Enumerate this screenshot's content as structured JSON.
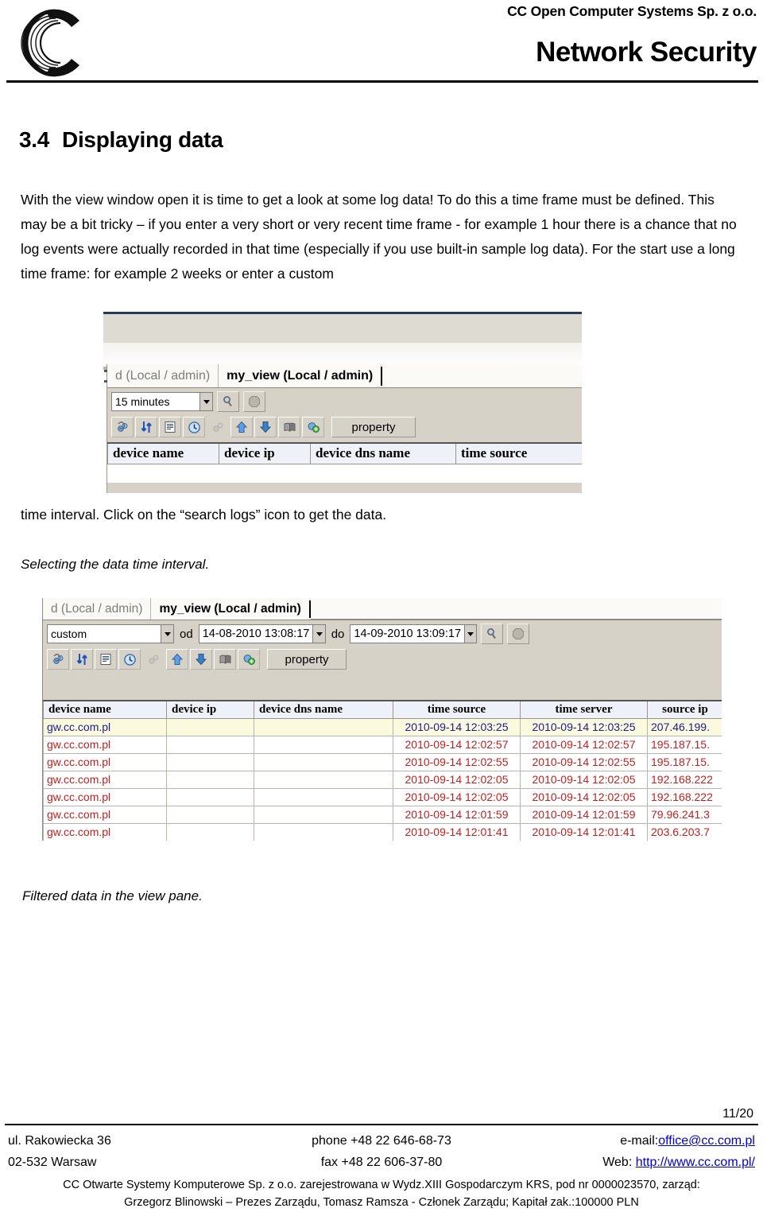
{
  "header": {
    "company": "CC Open Computer Systems Sp. z o.o.",
    "doc_title": "Network Security",
    "logo_icon": "cc-logo-arcs-icon"
  },
  "section": {
    "number": "3.4",
    "title": "Displaying data"
  },
  "body": {
    "paragraph1": "With the view window open it is time to get a look at some log data! To do this a time frame must be defined. This may be a bit tricky – if you enter a very short or very recent time frame - for example 1 hour there is a chance that no log events were actually recorded in that time (especially if you use built-in sample log data). For the start use a long time frame: for example 2 weeks or enter a custom",
    "paragraph1_cont": "time interval. Click on the “search logs” icon to get the data.",
    "caption1": "Selecting the data time interval.",
    "caption2": "Filtered data in the view pane."
  },
  "screenshot1": {
    "tabs": [
      {
        "label": "d (Local / admin)",
        "active": false
      },
      {
        "label": "my_view (Local / admin)",
        "active": true
      }
    ],
    "timeframe_combo": {
      "value": "15 minutes"
    },
    "buttons": {
      "search_logs": "search-logs-icon",
      "stop": "stop-icon",
      "property": "property"
    },
    "toolbar_icons": [
      "refresh-icon",
      "sort-updown-icon",
      "report-icon",
      "clock-icon",
      "filter-icon",
      "arrow-up-icon",
      "arrow-down-icon",
      "book-icon",
      "add-view-icon"
    ],
    "columns": [
      "device name",
      "device ip",
      "device dns name",
      "time source"
    ]
  },
  "screenshot2": {
    "tabs": [
      {
        "label": "d (Local / admin)",
        "active": false
      },
      {
        "label": "my_view (Local / admin)",
        "active": true
      }
    ],
    "timeframe_combo": {
      "value": "custom"
    },
    "from_label": "od",
    "from_value": "14-08-2010 13:08:17",
    "to_label": "do",
    "to_value": "14-09-2010 13:09:17",
    "buttons": {
      "search_logs": "search-logs-icon",
      "stop": "stop-icon",
      "property": "property"
    },
    "toolbar_icons": [
      "refresh-icon",
      "sort-updown-icon",
      "report-icon",
      "clock-icon",
      "filter-icon",
      "arrow-up-icon",
      "arrow-down-icon",
      "book-icon",
      "add-view-icon"
    ],
    "columns": [
      "device name",
      "device ip",
      "device dns name",
      "time source",
      "time server",
      "source ip"
    ],
    "rows": [
      {
        "selected": true,
        "device_name": "gw.cc.com.pl",
        "device_ip": "",
        "device_dns_name": "",
        "time_source": "2010-09-14 12:03:25",
        "time_server": "2010-09-14 12:03:25",
        "source_ip": "207.46.199."
      },
      {
        "selected": false,
        "device_name": "gw.cc.com.pl",
        "device_ip": "",
        "device_dns_name": "",
        "time_source": "2010-09-14 12:02:57",
        "time_server": "2010-09-14 12:02:57",
        "source_ip": "195.187.15."
      },
      {
        "selected": false,
        "device_name": "gw.cc.com.pl",
        "device_ip": "",
        "device_dns_name": "",
        "time_source": "2010-09-14 12:02:55",
        "time_server": "2010-09-14 12:02:55",
        "source_ip": "195.187.15."
      },
      {
        "selected": false,
        "device_name": "gw.cc.com.pl",
        "device_ip": "",
        "device_dns_name": "",
        "time_source": "2010-09-14 12:02:05",
        "time_server": "2010-09-14 12:02:05",
        "source_ip": "192.168.222"
      },
      {
        "selected": false,
        "device_name": "gw.cc.com.pl",
        "device_ip": "",
        "device_dns_name": "",
        "time_source": "2010-09-14 12:02:05",
        "time_server": "2010-09-14 12:02:05",
        "source_ip": "192.168.222"
      },
      {
        "selected": false,
        "device_name": "gw.cc.com.pl",
        "device_ip": "",
        "device_dns_name": "",
        "time_source": "2010-09-14 12:01:59",
        "time_server": "2010-09-14 12:01:59",
        "source_ip": "79.96.241.3"
      },
      {
        "selected": false,
        "device_name": "gw.cc.com.pl",
        "device_ip": "",
        "device_dns_name": "",
        "time_source": "2010-09-14 12:01:41",
        "time_server": "2010-09-14 12:01:41",
        "source_ip": "203.6.203.7"
      }
    ]
  },
  "footer": {
    "page": "11/20",
    "address1": "ul.  Rakowiecka 36",
    "address2": "02-532 Warsaw",
    "phone": "phone +48 22 646-68-73",
    "fax": "fax +48 22 606-37-80",
    "email_label": "e-mail:",
    "email": "office@cc.com.pl",
    "web_label": "Web: ",
    "web": "http://www.cc.com.pl/",
    "legal1": "CC Otwarte Systemy Komputerowe Sp. z o.o. zarejestrowana w Wydz.XIII Gospodarczym KRS, pod nr 0000023570, zarząd:",
    "legal2": "Grzegorz Blinowski  –  Prezes Zarządu, Tomasz Ramsza - Członek Zarządu; Kapitał zak.:100000 PLN"
  }
}
